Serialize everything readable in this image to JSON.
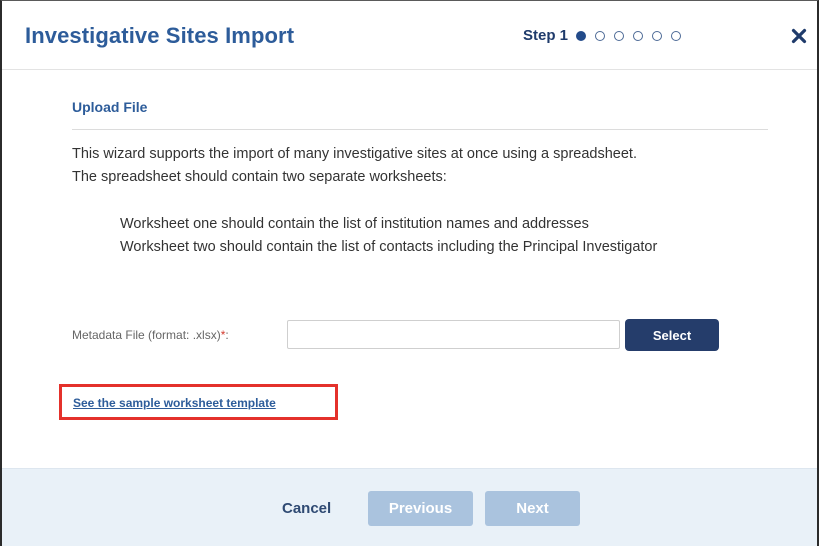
{
  "dialog": {
    "title": "Investigative Sites Import",
    "step_label": "Step 1",
    "steps": [
      {
        "state": "active"
      },
      {
        "state": "inactive"
      },
      {
        "state": "inactive"
      },
      {
        "state": "inactive"
      },
      {
        "state": "inactive"
      },
      {
        "state": "inactive"
      }
    ],
    "close_icon": "close-icon",
    "close_glyph": "✖"
  },
  "upload": {
    "section_title": "Upload File",
    "description_line1": "This wizard supports the import of many investigative sites at once using a spreadsheet.",
    "description_line2": "The spreadsheet should contain two separate worksheets:",
    "worksheet_one": "Worksheet one should contain the list of institution names and addresses",
    "worksheet_two": "Worksheet two should contain the list of contacts including the Principal Investigator",
    "file_label": "Metadata File (format: .xlsx)",
    "required_marker": "*",
    "file_label_suffix": ":",
    "file_value": "",
    "select_label": "Select",
    "sample_link": "See the sample worksheet template"
  },
  "footer": {
    "cancel_label": "Cancel",
    "previous_label": "Previous",
    "next_label": "Next"
  },
  "colors": {
    "title": "#2d5c9a",
    "select_button": "#253d6b",
    "disabled_button": "#aac3de",
    "footer_bg": "#e9f1f8",
    "highlight": "#e4312b"
  }
}
